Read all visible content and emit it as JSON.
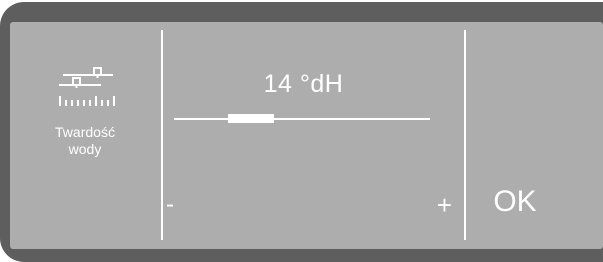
{
  "menu": {
    "icon": "water-hardness-icon",
    "label_line1": "Twardość",
    "label_line2": "wody"
  },
  "setting": {
    "value_display": "14 °dH",
    "slider_level": 0.3
  },
  "controls": {
    "minus_label": "-",
    "plus_label": "+",
    "ok_label": "OK"
  },
  "colors": {
    "bezel": "#5e5e5e",
    "screen": "#adadad",
    "foreground": "#ffffff"
  }
}
